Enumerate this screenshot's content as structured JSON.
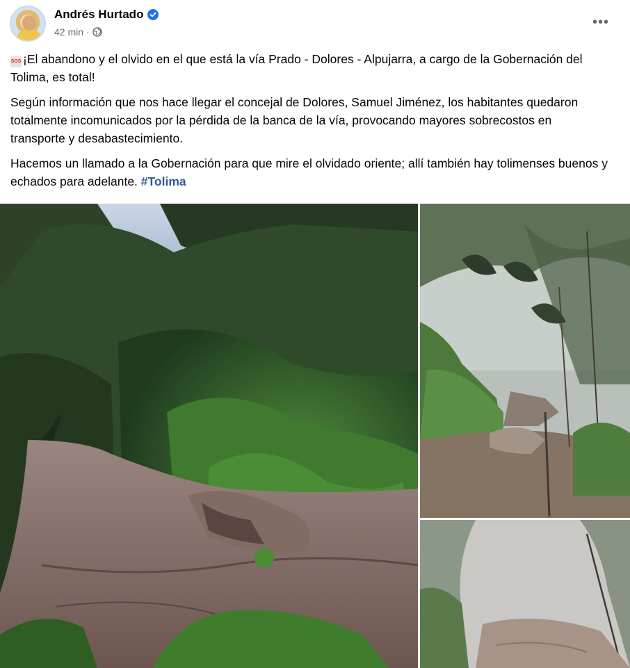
{
  "post": {
    "author": {
      "name": "Andrés Hurtado",
      "verified": true
    },
    "meta": {
      "time": "42 min",
      "separator": "·",
      "audience_icon": "globe-icon"
    },
    "more_options_icon": "more-options-icon",
    "text": {
      "sos_icon": "sos-icon",
      "sos_label": "SOS",
      "p1": "¡El abandono y el olvido en el que está la vía Prado - Dolores - Alpujarra, a cargo de la Gobernación del Tolima, es total!",
      "p2": "Según información que nos hace llegar el concejal de Dolores, Samuel Jiménez, los habitantes quedaron totalmente incomunicados por la pérdida de la banca de la vía, provocando mayores sobrecostos en transporte y desabastecimiento.",
      "p3": "Hacemos un llamado a la Gobernación para que mire el olvidado oriente; allí también hay tolimenses buenos y echados para adelante. ",
      "hashtag": "#Tolima"
    },
    "photos": [
      "road-landslide-photo",
      "foggy-road-trees-photo",
      "foggy-road-photo"
    ]
  },
  "colors": {
    "verified": "#1b74e4",
    "hashtag": "#385898",
    "secondary_text": "#65676b"
  }
}
